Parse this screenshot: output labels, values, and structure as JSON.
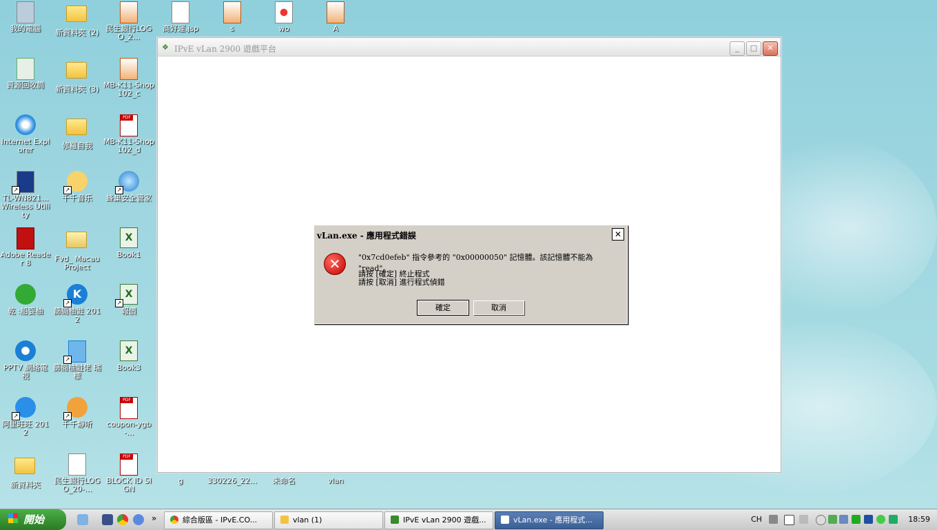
{
  "desktop": {
    "icons": [
      {
        "label": "我的電腦"
      },
      {
        "label": "新資料夾 (2)"
      },
      {
        "label": "民生銀行LOGO_2..."
      },
      {
        "label": "商好運.jsp"
      },
      {
        "label": "s"
      },
      {
        "label": "wo"
      },
      {
        "label": "A"
      },
      {
        "label": "資源回收筒"
      },
      {
        "label": "新資料夾 (3)"
      },
      {
        "label": "MB-K11-Shop102_c"
      },
      {
        "label": "Internet Explorer"
      },
      {
        "label": "修羅自我"
      },
      {
        "label": "MB-K11-Shop102_d"
      },
      {
        "label": "TL-WN821... Wireless Utility"
      },
      {
        "label": "千千音乐"
      },
      {
        "label": "蜂巢安全管家"
      },
      {
        "label": "Adobe Reader 8"
      },
      {
        "label": "Fvd_ Macau Project"
      },
      {
        "label": "Book1"
      },
      {
        "label": "乾 :船耍柚"
      },
      {
        "label": "篩簡柚鼪 2012"
      },
      {
        "label": "報價"
      },
      {
        "label": "PPTV 網絡電視"
      },
      {
        "label": "篩簡柚鼪佬 瑞標"
      },
      {
        "label": "Book3"
      },
      {
        "label": "阿里旺旺 2012"
      },
      {
        "label": "千千靜听"
      },
      {
        "label": "coupon-ygb-..."
      },
      {
        "label": "新資料夾"
      },
      {
        "label": "民生銀行LOGO_20-..."
      },
      {
        "label": "BLOCK ID SIGN"
      },
      {
        "label": "g"
      },
      {
        "label": "330226_22..."
      },
      {
        "label": "未命名"
      },
      {
        "label": "vlan"
      }
    ]
  },
  "main_window": {
    "title": "IPvE vLan 2900 遊戲平台",
    "minimize": "_",
    "maximize": "□",
    "close": "✕"
  },
  "dialog": {
    "title": "vLan.exe - 應用程式錯誤",
    "close": "✕",
    "message_line1": "\"0x7cd0efeb\" 指令參考的 \"0x00000050\" 記憶體。該記憶體不能為 \"read\"。",
    "message_line2": "請按 [確定] 終止程式",
    "message_line3": "請按 [取消] 進行程式偵錯",
    "ok_label": "確定",
    "cancel_label": "取消",
    "icon": "error-icon"
  },
  "taskbar": {
    "start_label": "開始",
    "chevron": "»",
    "tasks": [
      {
        "label": "綜合版區 - IPvE.CO..."
      },
      {
        "label": "vlan (1)"
      },
      {
        "label": "IPvE vLan 2900 遊戲..."
      },
      {
        "label": "vLan.exe - 應用程式..."
      }
    ],
    "lang": "CH",
    "clock": "18:59"
  }
}
